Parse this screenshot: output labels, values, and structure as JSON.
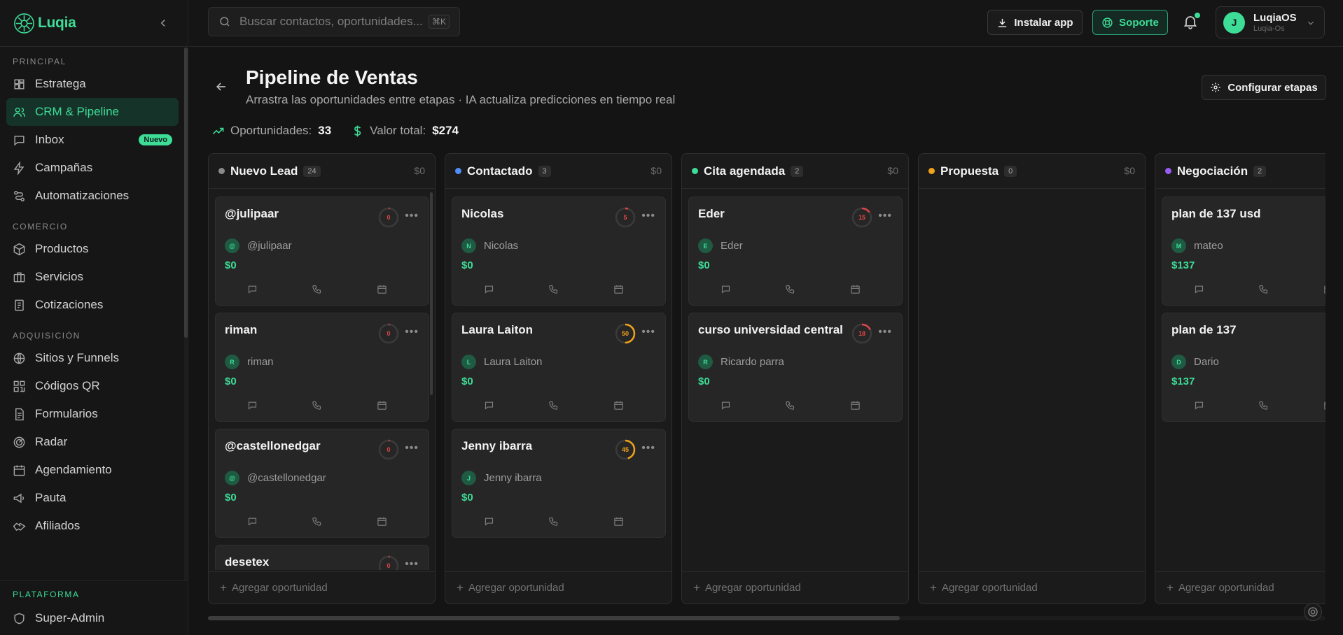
{
  "brand": {
    "name": "Luqia"
  },
  "sidebar": {
    "sections": [
      {
        "title": "PRINCIPAL",
        "items": [
          {
            "label": "Estratega",
            "icon": "dashboard-icon"
          },
          {
            "label": "CRM & Pipeline",
            "icon": "users-icon",
            "active": true
          },
          {
            "label": "Inbox",
            "icon": "message-icon",
            "badge": "Nuevo"
          },
          {
            "label": "Campañas",
            "icon": "zap-icon"
          },
          {
            "label": "Automatizaciones",
            "icon": "workflow-icon"
          }
        ]
      },
      {
        "title": "COMERCIO",
        "items": [
          {
            "label": "Productos",
            "icon": "box-icon"
          },
          {
            "label": "Servicios",
            "icon": "briefcase-icon"
          },
          {
            "label": "Cotizaciones",
            "icon": "receipt-icon"
          }
        ]
      },
      {
        "title": "ADQUISICIÓN",
        "items": [
          {
            "label": "Sitios y Funnels",
            "icon": "globe-icon"
          },
          {
            "label": "Códigos QR",
            "icon": "qr-icon"
          },
          {
            "label": "Formularios",
            "icon": "form-icon"
          },
          {
            "label": "Radar",
            "icon": "radar-icon"
          },
          {
            "label": "Agendamiento",
            "icon": "calendar-icon"
          },
          {
            "label": "Pauta",
            "icon": "megaphone-icon"
          },
          {
            "label": "Afiliados",
            "icon": "handshake-icon"
          }
        ]
      }
    ],
    "bottom": {
      "title": "PLATAFORMA",
      "item": {
        "label": "Super-Admin",
        "icon": "shield-icon"
      }
    }
  },
  "topbar": {
    "search_placeholder": "Buscar contactos, oportunidades...",
    "search_shortcut": "⌘K",
    "install_label": "Instalar app",
    "support_label": "Soporte",
    "user": {
      "name": "LuqiaOS",
      "subtitle": "Luqia-Os",
      "initial": "J"
    }
  },
  "page": {
    "title": "Pipeline de Ventas",
    "subtitle": "Arrastra las oportunidades entre etapas · IA actualiza predicciones en tiempo real",
    "config_label": "Configurar etapas",
    "stats": {
      "opportunities_label": "Oportunidades:",
      "opportunities_value": "33",
      "total_label": "Valor total:",
      "total_value": "$274"
    }
  },
  "add_label": "Agregar oportunidad",
  "columns": [
    {
      "title": "Nuevo Lead",
      "count": "24",
      "amount": "$0",
      "color": "#8a8a8a",
      "cards": [
        {
          "title": "@julipaar",
          "contact": "@julipaar",
          "initial": "@",
          "amount": "$0",
          "score": 0,
          "score_color": "#e04646"
        },
        {
          "title": "riman",
          "contact": "riman",
          "initial": "R",
          "amount": "$0",
          "score": 0,
          "score_color": "#e04646"
        },
        {
          "title": "@castellonedgar",
          "contact": "@castellonedgar",
          "initial": "@",
          "amount": "$0",
          "score": 0,
          "score_color": "#e04646"
        },
        {
          "title": "desetex",
          "contact": "",
          "initial": "",
          "amount": "",
          "score": 0,
          "score_color": "#e04646"
        }
      ]
    },
    {
      "title": "Contactado",
      "count": "3",
      "amount": "$0",
      "color": "#4f8ef7",
      "cards": [
        {
          "title": "Nicolas",
          "contact": "Nicolas",
          "initial": "N",
          "amount": "$0",
          "score": 5,
          "score_color": "#e04646"
        },
        {
          "title": "Laura Laiton",
          "contact": "Laura Laiton",
          "initial": "L",
          "amount": "$0",
          "score": 50,
          "score_color": "#f0a21a"
        },
        {
          "title": "Jenny ibarra",
          "contact": "Jenny ibarra",
          "initial": "J",
          "amount": "$0",
          "score": 45,
          "score_color": "#f0a21a"
        }
      ]
    },
    {
      "title": "Cita agendada",
      "count": "2",
      "amount": "$0",
      "color": "#3ddc97",
      "cards": [
        {
          "title": "Eder",
          "contact": "Eder",
          "initial": "E",
          "amount": "$0",
          "score": 15,
          "score_color": "#e04646"
        },
        {
          "title": "curso universidad central",
          "contact": "Ricardo parra",
          "initial": "R",
          "amount": "$0",
          "score": 18,
          "score_color": "#e04646"
        }
      ]
    },
    {
      "title": "Propuesta",
      "count": "0",
      "amount": "$0",
      "color": "#f0a21a",
      "cards": []
    },
    {
      "title": "Negociación",
      "count": "2",
      "amount": "",
      "color": "#9b5cf6",
      "cards": [
        {
          "title": "plan de 137 usd",
          "contact": "mateo",
          "initial": "M",
          "amount": "$137",
          "score": null,
          "score_color": "#8a8a8a"
        },
        {
          "title": "plan de 137",
          "contact": "Dario",
          "initial": "D",
          "amount": "$137",
          "score": null,
          "score_color": "#8a8a8a"
        }
      ]
    }
  ]
}
